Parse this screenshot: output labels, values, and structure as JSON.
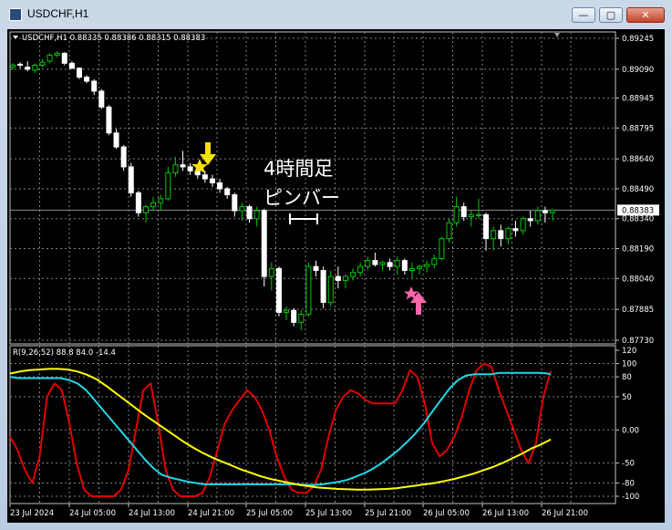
{
  "window": {
    "title": "USDCHF,H1",
    "buttons": {
      "minimize": "—",
      "maximize": "▢",
      "close": "✕"
    }
  },
  "main_chart": {
    "header": "USDCHF,H1 0.88335 0.88386 0.88315 0.88383",
    "price_labels": [
      "0.89245",
      "0.89090",
      "0.88945",
      "0.88795",
      "0.88640",
      "0.88490",
      "0.88340",
      "0.88190",
      "0.88040",
      "0.87885",
      "0.87730"
    ],
    "current_price": "0.88383",
    "annotation_line1": "4時間足",
    "annotation_line2": "ピンバー",
    "colors": {
      "bull": "#00c800",
      "bear": "#ffffff",
      "grid": "#808080",
      "arrow_down": "#ffe000",
      "arrow_up": "#ff66aa"
    }
  },
  "indicator": {
    "header": "R(9,26,52) 88.8 84.0 -14.4",
    "scale_labels": [
      "120",
      "100",
      "80",
      "50",
      "0.00",
      "-50",
      "-80",
      "-100"
    ],
    "series": [
      {
        "color": "#e00000",
        "values": [
          -10,
          -30,
          -60,
          -80,
          -40,
          50,
          70,
          60,
          10,
          -50,
          -90,
          -100,
          -100,
          -100,
          -100,
          -90,
          -60,
          0,
          60,
          70,
          10,
          -60,
          -90,
          -100,
          -100,
          -100,
          -95,
          -70,
          -30,
          10,
          30,
          45,
          60,
          50,
          30,
          0,
          -40,
          -70,
          -90,
          -95,
          -95,
          -85,
          -60,
          -10,
          30,
          50,
          60,
          55,
          45,
          40,
          40,
          40,
          40,
          60,
          90,
          80,
          40,
          -20,
          -40,
          -30,
          -10,
          20,
          60,
          90,
          100,
          95,
          60,
          30,
          0,
          -30,
          -50,
          -20,
          50,
          88.8
        ]
      },
      {
        "color": "#20d8e8",
        "values": [
          80,
          78,
          78,
          78,
          78,
          78,
          78,
          75,
          70,
          60,
          45,
          30,
          15,
          0,
          -15,
          -30,
          -45,
          -58,
          -68,
          -72,
          -75,
          -78,
          -80,
          -82,
          -82,
          -82,
          -82,
          -82,
          -82,
          -82,
          -82,
          -82,
          -82,
          -82,
          -82,
          -83,
          -83,
          -82,
          -80,
          -78,
          -75,
          -70,
          -65,
          -58,
          -50,
          -40,
          -30,
          -18,
          -5,
          10,
          28,
          45,
          62,
          75,
          82,
          84,
          84,
          84,
          86,
          86,
          86,
          86,
          86,
          86,
          84.0
        ]
      },
      {
        "color": "#ffff00",
        "values": [
          85,
          88,
          90,
          91,
          92,
          92,
          91,
          88,
          83,
          76,
          66,
          55,
          44,
          33,
          22,
          12,
          2,
          -8,
          -18,
          -27,
          -35,
          -42,
          -48,
          -54,
          -60,
          -65,
          -70,
          -74,
          -77,
          -80,
          -83,
          -85,
          -87,
          -88,
          -89,
          -89.5,
          -90,
          -90,
          -89.5,
          -89,
          -88,
          -86,
          -84,
          -82,
          -80,
          -77,
          -74,
          -70,
          -66,
          -61,
          -56,
          -50,
          -43,
          -36,
          -28,
          -22,
          -14.4
        ]
      }
    ]
  },
  "time_labels": [
    "23 Jul 2024",
    "24 Jul 05:00",
    "24 Jul 13:00",
    "24 Jul 21:00",
    "25 Jul 05:00",
    "25 Jul 13:00",
    "25 Jul 21:00",
    "26 Jul 05:00",
    "26 Jul 13:00",
    "26 Jul 21:00"
  ],
  "candles": [
    [
      0.891,
      0.8912,
      0.89085,
      0.8911
    ],
    [
      0.89115,
      0.89125,
      0.89095,
      0.8911
    ],
    [
      0.891,
      0.8913,
      0.8908,
      0.8909
    ],
    [
      0.89085,
      0.8912,
      0.8907,
      0.8911
    ],
    [
      0.8911,
      0.8914,
      0.891,
      0.89125
    ],
    [
      0.8913,
      0.8917,
      0.8912,
      0.8916
    ],
    [
      0.8916,
      0.8918,
      0.8915,
      0.8917
    ],
    [
      0.8917,
      0.89175,
      0.8911,
      0.8912
    ],
    [
      0.8912,
      0.8913,
      0.8909,
      0.89095
    ],
    [
      0.89095,
      0.891,
      0.8904,
      0.8905
    ],
    [
      0.8905,
      0.8906,
      0.8902,
      0.8903
    ],
    [
      0.8903,
      0.8904,
      0.8896,
      0.8898
    ],
    [
      0.8898,
      0.8899,
      0.8889,
      0.889
    ],
    [
      0.889,
      0.8891,
      0.8876,
      0.8877
    ],
    [
      0.8877,
      0.8879,
      0.8869,
      0.887
    ],
    [
      0.887,
      0.8871,
      0.8858,
      0.886
    ],
    [
      0.886,
      0.8862,
      0.8845,
      0.8847
    ],
    [
      0.8847,
      0.8848,
      0.8835,
      0.8837
    ],
    [
      0.8837,
      0.8841,
      0.8832,
      0.884
    ],
    [
      0.884,
      0.8845,
      0.8838,
      0.8842
    ],
    [
      0.8842,
      0.8846,
      0.8838,
      0.8844
    ],
    [
      0.8844,
      0.886,
      0.8843,
      0.8857
    ],
    [
      0.8857,
      0.8865,
      0.8855,
      0.8861
    ],
    [
      0.8861,
      0.8868,
      0.8858,
      0.886
    ],
    [
      0.886,
      0.8862,
      0.8856,
      0.8858
    ],
    [
      0.8858,
      0.886,
      0.8854,
      0.8856
    ],
    [
      0.8856,
      0.8858,
      0.8852,
      0.8854
    ],
    [
      0.8854,
      0.8856,
      0.885,
      0.8852
    ],
    [
      0.8852,
      0.8854,
      0.8847,
      0.8849
    ],
    [
      0.8849,
      0.885,
      0.8844,
      0.8846
    ],
    [
      0.8846,
      0.8847,
      0.8835,
      0.8838
    ],
    [
      0.8838,
      0.8842,
      0.8833,
      0.884
    ],
    [
      0.884,
      0.8841,
      0.8832,
      0.8834
    ],
    [
      0.8834,
      0.884,
      0.883,
      0.8838
    ],
    [
      0.8838,
      0.8839,
      0.88,
      0.8805
    ],
    [
      0.8805,
      0.8812,
      0.8798,
      0.8809
    ],
    [
      0.8809,
      0.881,
      0.8785,
      0.8787
    ],
    [
      0.8787,
      0.879,
      0.8783,
      0.8788
    ],
    [
      0.8788,
      0.8789,
      0.878,
      0.8782
    ],
    [
      0.8782,
      0.8788,
      0.8778,
      0.8786
    ],
    [
      0.8786,
      0.8812,
      0.8785,
      0.881
    ],
    [
      0.881,
      0.8813,
      0.8805,
      0.8808
    ],
    [
      0.8808,
      0.881,
      0.8789,
      0.8792
    ],
    [
      0.8792,
      0.8808,
      0.879,
      0.8805
    ],
    [
      0.8805,
      0.881,
      0.8799,
      0.8803
    ],
    [
      0.8803,
      0.8806,
      0.8799,
      0.8805
    ],
    [
      0.8805,
      0.8809,
      0.8803,
      0.8807
    ],
    [
      0.8807,
      0.8812,
      0.8805,
      0.881
    ],
    [
      0.881,
      0.8815,
      0.8808,
      0.8813
    ],
    [
      0.8813,
      0.8817,
      0.881,
      0.8811
    ],
    [
      0.8811,
      0.8813,
      0.8808,
      0.8812
    ],
    [
      0.8812,
      0.8814,
      0.8808,
      0.881
    ],
    [
      0.881,
      0.8815,
      0.8806,
      0.8813
    ],
    [
      0.8813,
      0.8814,
      0.8806,
      0.8808
    ],
    [
      0.8808,
      0.8812,
      0.8804,
      0.8809
    ],
    [
      0.8809,
      0.8811,
      0.8806,
      0.881
    ],
    [
      0.881,
      0.8813,
      0.8807,
      0.8811
    ],
    [
      0.8811,
      0.8816,
      0.8809,
      0.8814
    ],
    [
      0.8814,
      0.8825,
      0.8813,
      0.8824
    ],
    [
      0.8824,
      0.8834,
      0.8822,
      0.8832
    ],
    [
      0.8832,
      0.8845,
      0.883,
      0.884
    ],
    [
      0.884,
      0.8842,
      0.8833,
      0.8835
    ],
    [
      0.8835,
      0.8838,
      0.883,
      0.8836
    ],
    [
      0.8836,
      0.8844,
      0.8834,
      0.8836
    ],
    [
      0.8836,
      0.8837,
      0.8818,
      0.8824
    ],
    [
      0.8824,
      0.883,
      0.8818,
      0.8828
    ],
    [
      0.8828,
      0.8831,
      0.882,
      0.8824
    ],
    [
      0.8824,
      0.883,
      0.8821,
      0.8829
    ],
    [
      0.8829,
      0.8833,
      0.8825,
      0.8828
    ],
    [
      0.8828,
      0.8835,
      0.8826,
      0.8834
    ],
    [
      0.8834,
      0.8838,
      0.883,
      0.8833
    ],
    [
      0.8833,
      0.884,
      0.8831,
      0.8838
    ],
    [
      0.8838,
      0.884,
      0.8832,
      0.8837
    ],
    [
      0.8837,
      0.8839,
      0.8833,
      0.88383
    ]
  ]
}
